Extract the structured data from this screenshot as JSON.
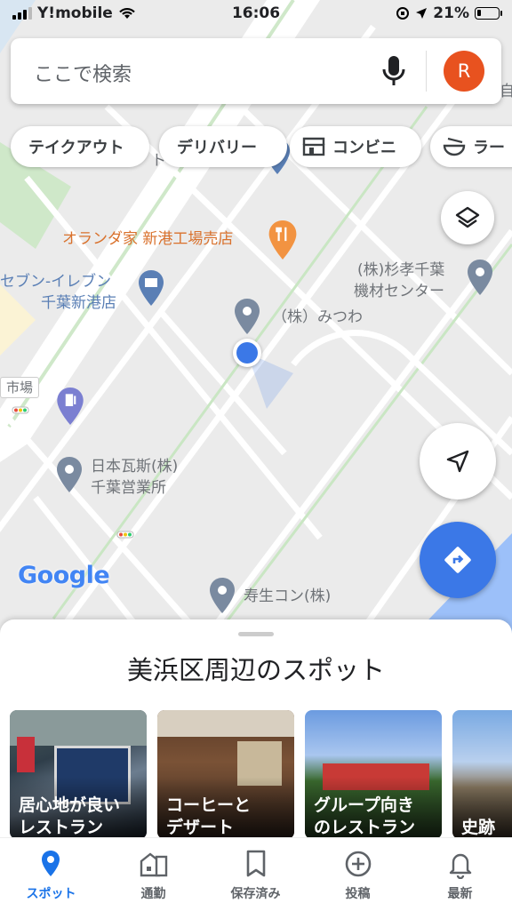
{
  "status_bar": {
    "carrier": "Y!mobile",
    "time": "16:06",
    "battery": "21%",
    "battery_level": 0.21
  },
  "search": {
    "placeholder": "ここで検索",
    "avatar_letter": "R"
  },
  "chips": [
    "テイクアウト",
    "デリバリー",
    "コンビニ",
    "ラー"
  ],
  "map": {
    "labels": {
      "orange_house": "オランダ家 新港工場売店",
      "seven_line1": "セブン-イレブン",
      "seven_line2": "千葉新港店",
      "sugitaka_line1": "(株)杉孝千葉",
      "sugitaka_line2": "機材センター",
      "mitsuwa": "（株）みつわ",
      "market": "市場",
      "nihon_gas_line1": "日本瓦斯(株)",
      "nihon_gas_line2": "千葉営業所",
      "jusei": "寿生コン(株)",
      "ku_text": "ト",
      "edge_char": "自",
      "google_logo": "Google"
    }
  },
  "sheet": {
    "title": "美浜区周辺のスポット",
    "cards": [
      {
        "line1": "居心地が良い",
        "line2": "レストラン"
      },
      {
        "line1": "コーヒーと",
        "line2": "デザート"
      },
      {
        "line1": "グループ向き",
        "line2": "のレストラン"
      },
      {
        "line1": "史跡",
        "line2": ""
      }
    ]
  },
  "tabs": [
    {
      "label": "スポット",
      "icon": "pin-icon",
      "active": true
    },
    {
      "label": "通勤",
      "icon": "commute-icon",
      "active": false
    },
    {
      "label": "保存済み",
      "icon": "bookmark-icon",
      "active": false
    },
    {
      "label": "投稿",
      "icon": "add-circle-icon",
      "active": false
    },
    {
      "label": "最新",
      "icon": "bell-icon",
      "active": false
    }
  ],
  "colors": {
    "accent": "#1a73e8",
    "fab": "#3b78e7",
    "avatar": "#e8521f",
    "poi_orange": "#d9712c",
    "poi_blue": "#5a7fb5"
  }
}
